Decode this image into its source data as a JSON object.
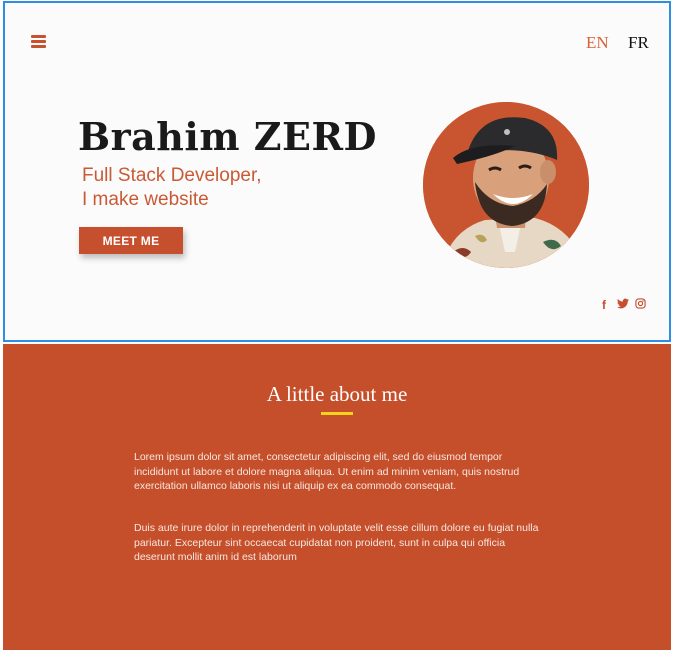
{
  "nav": {
    "lang_en": "EN",
    "lang_fr": "FR",
    "menu_icon": "hamburger-menu-icon"
  },
  "hero": {
    "name": "Brahim ZERD",
    "subtitle_line1": "Full Stack Developer,",
    "subtitle_line2": "I make website",
    "cta_label": "MEET ME"
  },
  "social": {
    "facebook_glyph": "f",
    "twitter_icon": "twitter-icon",
    "instagram_icon": "instagram-icon"
  },
  "about": {
    "title": "A little about me",
    "paragraph1": "Lorem ipsum dolor sit amet, consectetur adipiscing elit, sed do eiusmod tempor incididunt ut labore et dolore magna aliqua. Ut enim ad minim veniam, quis nostrud exercitation ullamco laboris nisi ut aliquip ex ea commodo consequat.",
    "paragraph2": " Duis aute irure dolor in reprehenderit in voluptate velit esse cillum dolore eu fugiat nulla pariatur. Excepteur sint occaecat cupidatat non proident, sunt in culpa qui officia deserunt mollit anim id est laborum"
  },
  "colors": {
    "accent": "#c64f2e",
    "underline": "#f2d21b",
    "hero_bg": "#fbfbfb",
    "selection_border": "#2d8fe3"
  }
}
